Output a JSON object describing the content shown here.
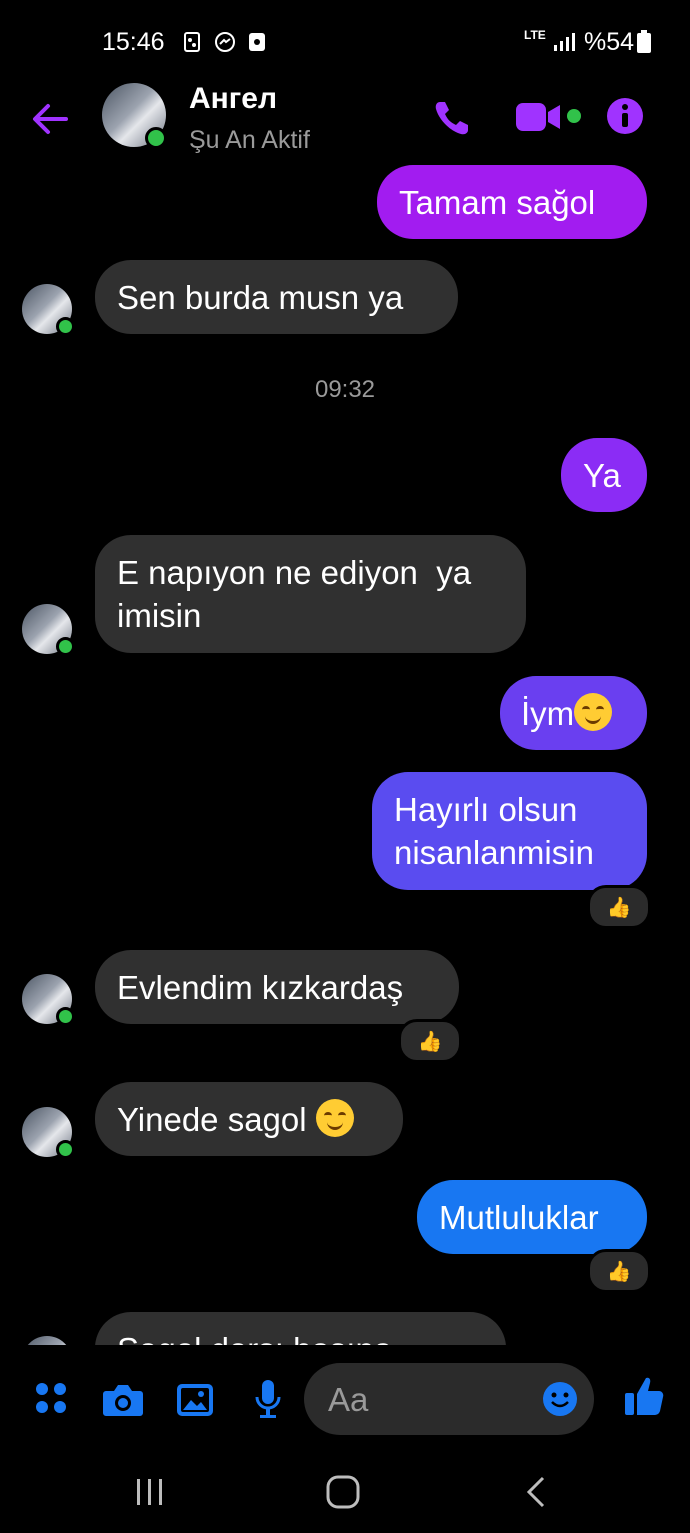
{
  "status_bar": {
    "time": "15:46",
    "network": "LTE",
    "battery": "%54",
    "icons": [
      "screenshot-icon",
      "messenger-icon",
      "sd-card-icon",
      "signal-icon",
      "battery-icon"
    ]
  },
  "header": {
    "contact_name": "Ангел",
    "status": "Şu An Aktif",
    "icons": [
      "back-arrow-icon",
      "phone-icon",
      "video-camera-icon",
      "info-icon"
    ],
    "accent_color": "#a033ff"
  },
  "messages": [
    {
      "from": "me",
      "text": "Tamam sağol",
      "color": "#a21cf0"
    },
    {
      "from": "them",
      "text": "Sen burda musn ya"
    },
    {
      "timestamp": "09:32"
    },
    {
      "from": "me",
      "text": "Ya",
      "color": "#8b2cf5"
    },
    {
      "from": "them",
      "text": "E napıyon ne ediyon  ya\nimisin"
    },
    {
      "from": "me",
      "text": "İym",
      "emoji": "smirk",
      "color": "#6a3ff0"
    },
    {
      "from": "me",
      "text": "Hayırlı olsun\nnisanlanmisin",
      "color": "#5a4cf0",
      "reaction": "👍"
    },
    {
      "from": "them",
      "text": "Evlendim kızkardaş",
      "reaction": "👍"
    },
    {
      "from": "them",
      "text": "Yinede sagol ",
      "emoji": "smile"
    },
    {
      "from": "me",
      "text": "Mutluluklar",
      "color": "#1877f2",
      "reaction": "👍"
    },
    {
      "from": "them",
      "text": "Sagol dorşı başına",
      "partially_visible": true
    }
  ],
  "composer": {
    "placeholder": "Aa",
    "icons": [
      "menu-dots-icon",
      "camera-icon",
      "gallery-icon",
      "microphone-icon",
      "emoji-icon",
      "thumbs-up-icon"
    ],
    "icon_color": "#1877f2"
  },
  "nav_bar": {
    "icons": [
      "recent-apps-icon",
      "home-icon",
      "back-icon"
    ]
  }
}
